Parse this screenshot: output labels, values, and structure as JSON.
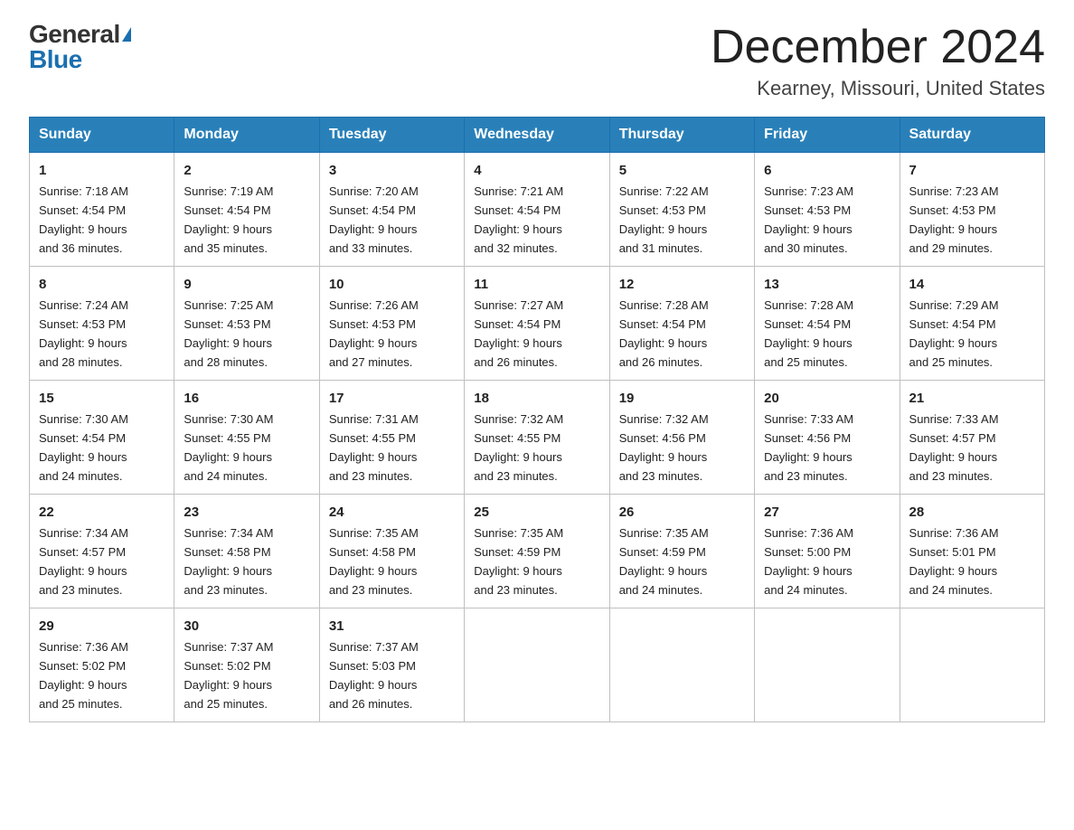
{
  "logo": {
    "general": "General",
    "blue": "Blue"
  },
  "title": "December 2024",
  "location": "Kearney, Missouri, United States",
  "days_of_week": [
    "Sunday",
    "Monday",
    "Tuesday",
    "Wednesday",
    "Thursday",
    "Friday",
    "Saturday"
  ],
  "weeks": [
    [
      {
        "day": "1",
        "sunrise": "7:18 AM",
        "sunset": "4:54 PM",
        "daylight": "9 hours and 36 minutes."
      },
      {
        "day": "2",
        "sunrise": "7:19 AM",
        "sunset": "4:54 PM",
        "daylight": "9 hours and 35 minutes."
      },
      {
        "day": "3",
        "sunrise": "7:20 AM",
        "sunset": "4:54 PM",
        "daylight": "9 hours and 33 minutes."
      },
      {
        "day": "4",
        "sunrise": "7:21 AM",
        "sunset": "4:54 PM",
        "daylight": "9 hours and 32 minutes."
      },
      {
        "day": "5",
        "sunrise": "7:22 AM",
        "sunset": "4:53 PM",
        "daylight": "9 hours and 31 minutes."
      },
      {
        "day": "6",
        "sunrise": "7:23 AM",
        "sunset": "4:53 PM",
        "daylight": "9 hours and 30 minutes."
      },
      {
        "day": "7",
        "sunrise": "7:23 AM",
        "sunset": "4:53 PM",
        "daylight": "9 hours and 29 minutes."
      }
    ],
    [
      {
        "day": "8",
        "sunrise": "7:24 AM",
        "sunset": "4:53 PM",
        "daylight": "9 hours and 28 minutes."
      },
      {
        "day": "9",
        "sunrise": "7:25 AM",
        "sunset": "4:53 PM",
        "daylight": "9 hours and 28 minutes."
      },
      {
        "day": "10",
        "sunrise": "7:26 AM",
        "sunset": "4:53 PM",
        "daylight": "9 hours and 27 minutes."
      },
      {
        "day": "11",
        "sunrise": "7:27 AM",
        "sunset": "4:54 PM",
        "daylight": "9 hours and 26 minutes."
      },
      {
        "day": "12",
        "sunrise": "7:28 AM",
        "sunset": "4:54 PM",
        "daylight": "9 hours and 26 minutes."
      },
      {
        "day": "13",
        "sunrise": "7:28 AM",
        "sunset": "4:54 PM",
        "daylight": "9 hours and 25 minutes."
      },
      {
        "day": "14",
        "sunrise": "7:29 AM",
        "sunset": "4:54 PM",
        "daylight": "9 hours and 25 minutes."
      }
    ],
    [
      {
        "day": "15",
        "sunrise": "7:30 AM",
        "sunset": "4:54 PM",
        "daylight": "9 hours and 24 minutes."
      },
      {
        "day": "16",
        "sunrise": "7:30 AM",
        "sunset": "4:55 PM",
        "daylight": "9 hours and 24 minutes."
      },
      {
        "day": "17",
        "sunrise": "7:31 AM",
        "sunset": "4:55 PM",
        "daylight": "9 hours and 23 minutes."
      },
      {
        "day": "18",
        "sunrise": "7:32 AM",
        "sunset": "4:55 PM",
        "daylight": "9 hours and 23 minutes."
      },
      {
        "day": "19",
        "sunrise": "7:32 AM",
        "sunset": "4:56 PM",
        "daylight": "9 hours and 23 minutes."
      },
      {
        "day": "20",
        "sunrise": "7:33 AM",
        "sunset": "4:56 PM",
        "daylight": "9 hours and 23 minutes."
      },
      {
        "day": "21",
        "sunrise": "7:33 AM",
        "sunset": "4:57 PM",
        "daylight": "9 hours and 23 minutes."
      }
    ],
    [
      {
        "day": "22",
        "sunrise": "7:34 AM",
        "sunset": "4:57 PM",
        "daylight": "9 hours and 23 minutes."
      },
      {
        "day": "23",
        "sunrise": "7:34 AM",
        "sunset": "4:58 PM",
        "daylight": "9 hours and 23 minutes."
      },
      {
        "day": "24",
        "sunrise": "7:35 AM",
        "sunset": "4:58 PM",
        "daylight": "9 hours and 23 minutes."
      },
      {
        "day": "25",
        "sunrise": "7:35 AM",
        "sunset": "4:59 PM",
        "daylight": "9 hours and 23 minutes."
      },
      {
        "day": "26",
        "sunrise": "7:35 AM",
        "sunset": "4:59 PM",
        "daylight": "9 hours and 24 minutes."
      },
      {
        "day": "27",
        "sunrise": "7:36 AM",
        "sunset": "5:00 PM",
        "daylight": "9 hours and 24 minutes."
      },
      {
        "day": "28",
        "sunrise": "7:36 AM",
        "sunset": "5:01 PM",
        "daylight": "9 hours and 24 minutes."
      }
    ],
    [
      {
        "day": "29",
        "sunrise": "7:36 AM",
        "sunset": "5:02 PM",
        "daylight": "9 hours and 25 minutes."
      },
      {
        "day": "30",
        "sunrise": "7:37 AM",
        "sunset": "5:02 PM",
        "daylight": "9 hours and 25 minutes."
      },
      {
        "day": "31",
        "sunrise": "7:37 AM",
        "sunset": "5:03 PM",
        "daylight": "9 hours and 26 minutes."
      },
      null,
      null,
      null,
      null
    ]
  ],
  "labels": {
    "sunrise": "Sunrise:",
    "sunset": "Sunset:",
    "daylight": "Daylight:"
  }
}
